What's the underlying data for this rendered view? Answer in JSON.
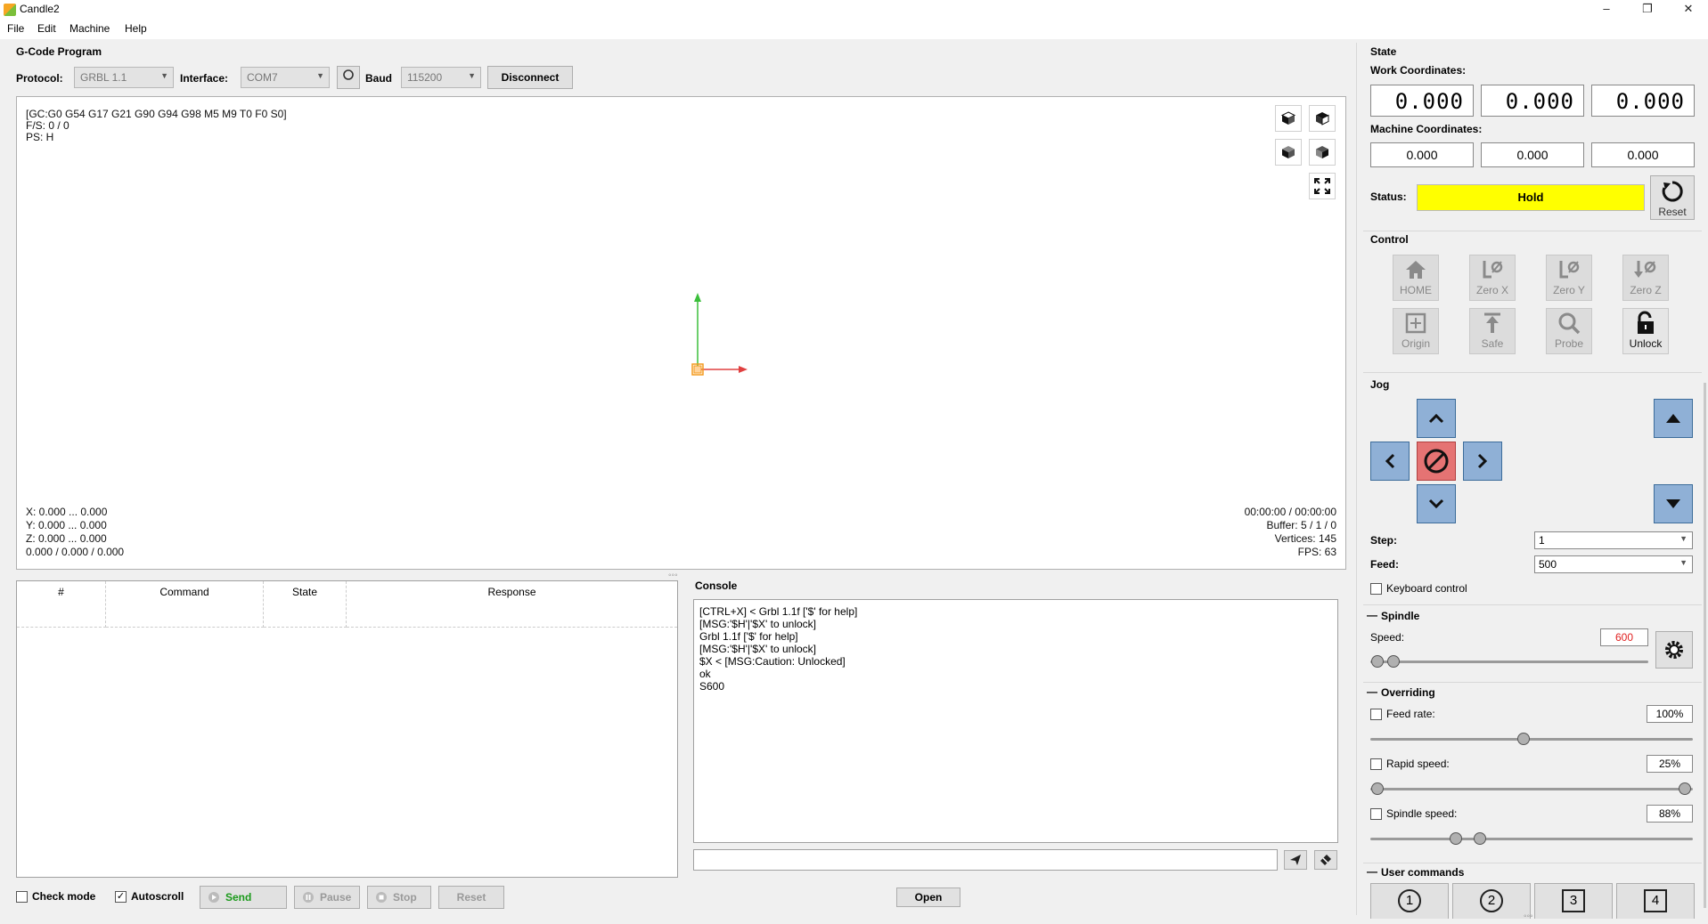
{
  "window": {
    "title": "Candle2",
    "minimize": "–",
    "restore": "❐",
    "close": "✕"
  },
  "menu": [
    "File",
    "Edit",
    "Machine",
    "Help"
  ],
  "gcode": {
    "title": "G-Code Program",
    "protocol_label": "Protocol:",
    "protocol_value": "GRBL 1.1",
    "interface_label": "Interface:",
    "interface_value": "COM7",
    "baud_label": "Baud",
    "baud_value": "115200",
    "disconnect_label": "Disconnect"
  },
  "viewport": {
    "top_lines": [
      "[GC:G0 G54 G17 G21 G90 G94 G98 M5 M9 T0 F0 S0]",
      "F/S: 0 / 0",
      "PS: H"
    ],
    "bottom_left": [
      "X: 0.000 ... 0.000",
      "Y: 0.000 ... 0.000",
      "Z: 0.000 ... 0.000",
      "0.000 / 0.000 / 0.000"
    ],
    "bottom_right": [
      "00:00:00 / 00:00:00",
      "Buffer: 5 / 1 / 0",
      "Vertices: 145",
      "FPS: 63"
    ]
  },
  "table": {
    "headers": [
      "#",
      "Command",
      "State",
      "Response"
    ]
  },
  "console": {
    "title": "Console",
    "lines": [
      "[CTRL+X] < Grbl 1.1f ['$' for help]",
      "[MSG:'$H'|'$X' to unlock]",
      "Grbl 1.1f ['$' for help]",
      "[MSG:'$H'|'$X' to unlock]",
      "$X < [MSG:Caution: Unlocked]",
      "ok",
      "S600"
    ],
    "open_label": "Open"
  },
  "bottom_bar": {
    "check_mode": "Check mode",
    "autoscroll": "Autoscroll",
    "send": "Send",
    "pause": "Pause",
    "stop": "Stop",
    "reset": "Reset"
  },
  "state": {
    "title": "State",
    "work_label": "Work Coordinates:",
    "work": [
      "0.000",
      "0.000",
      "0.000"
    ],
    "machine_label": "Machine Coordinates:",
    "machine": [
      "0.000",
      "0.000",
      "0.000"
    ],
    "status_label": "Status:",
    "status_value": "Hold",
    "status_color": "#ffff00",
    "reset_label": "Reset"
  },
  "control": {
    "title": "Control",
    "buttons": [
      "HOME",
      "Zero X",
      "Zero Y",
      "Zero Z",
      "Origin",
      "Safe",
      "Probe",
      "Unlock"
    ]
  },
  "jog": {
    "title": "Jog",
    "step_label": "Step:",
    "step_value": "1",
    "feed_label": "Feed:",
    "feed_value": "500",
    "keyboard_label": "Keyboard control"
  },
  "spindle": {
    "title": "Spindle",
    "speed_label": "Speed:",
    "speed_value": "600"
  },
  "overriding": {
    "title": "Overriding",
    "feed_label": "Feed rate:",
    "feed_value": "100%",
    "rapid_label": "Rapid speed:",
    "rapid_value": "25%",
    "spindle_label": "Spindle speed:",
    "spindle_value": "88%"
  },
  "user_commands": {
    "title": "User commands",
    "buttons": [
      "1",
      "2",
      "3",
      "4"
    ]
  }
}
